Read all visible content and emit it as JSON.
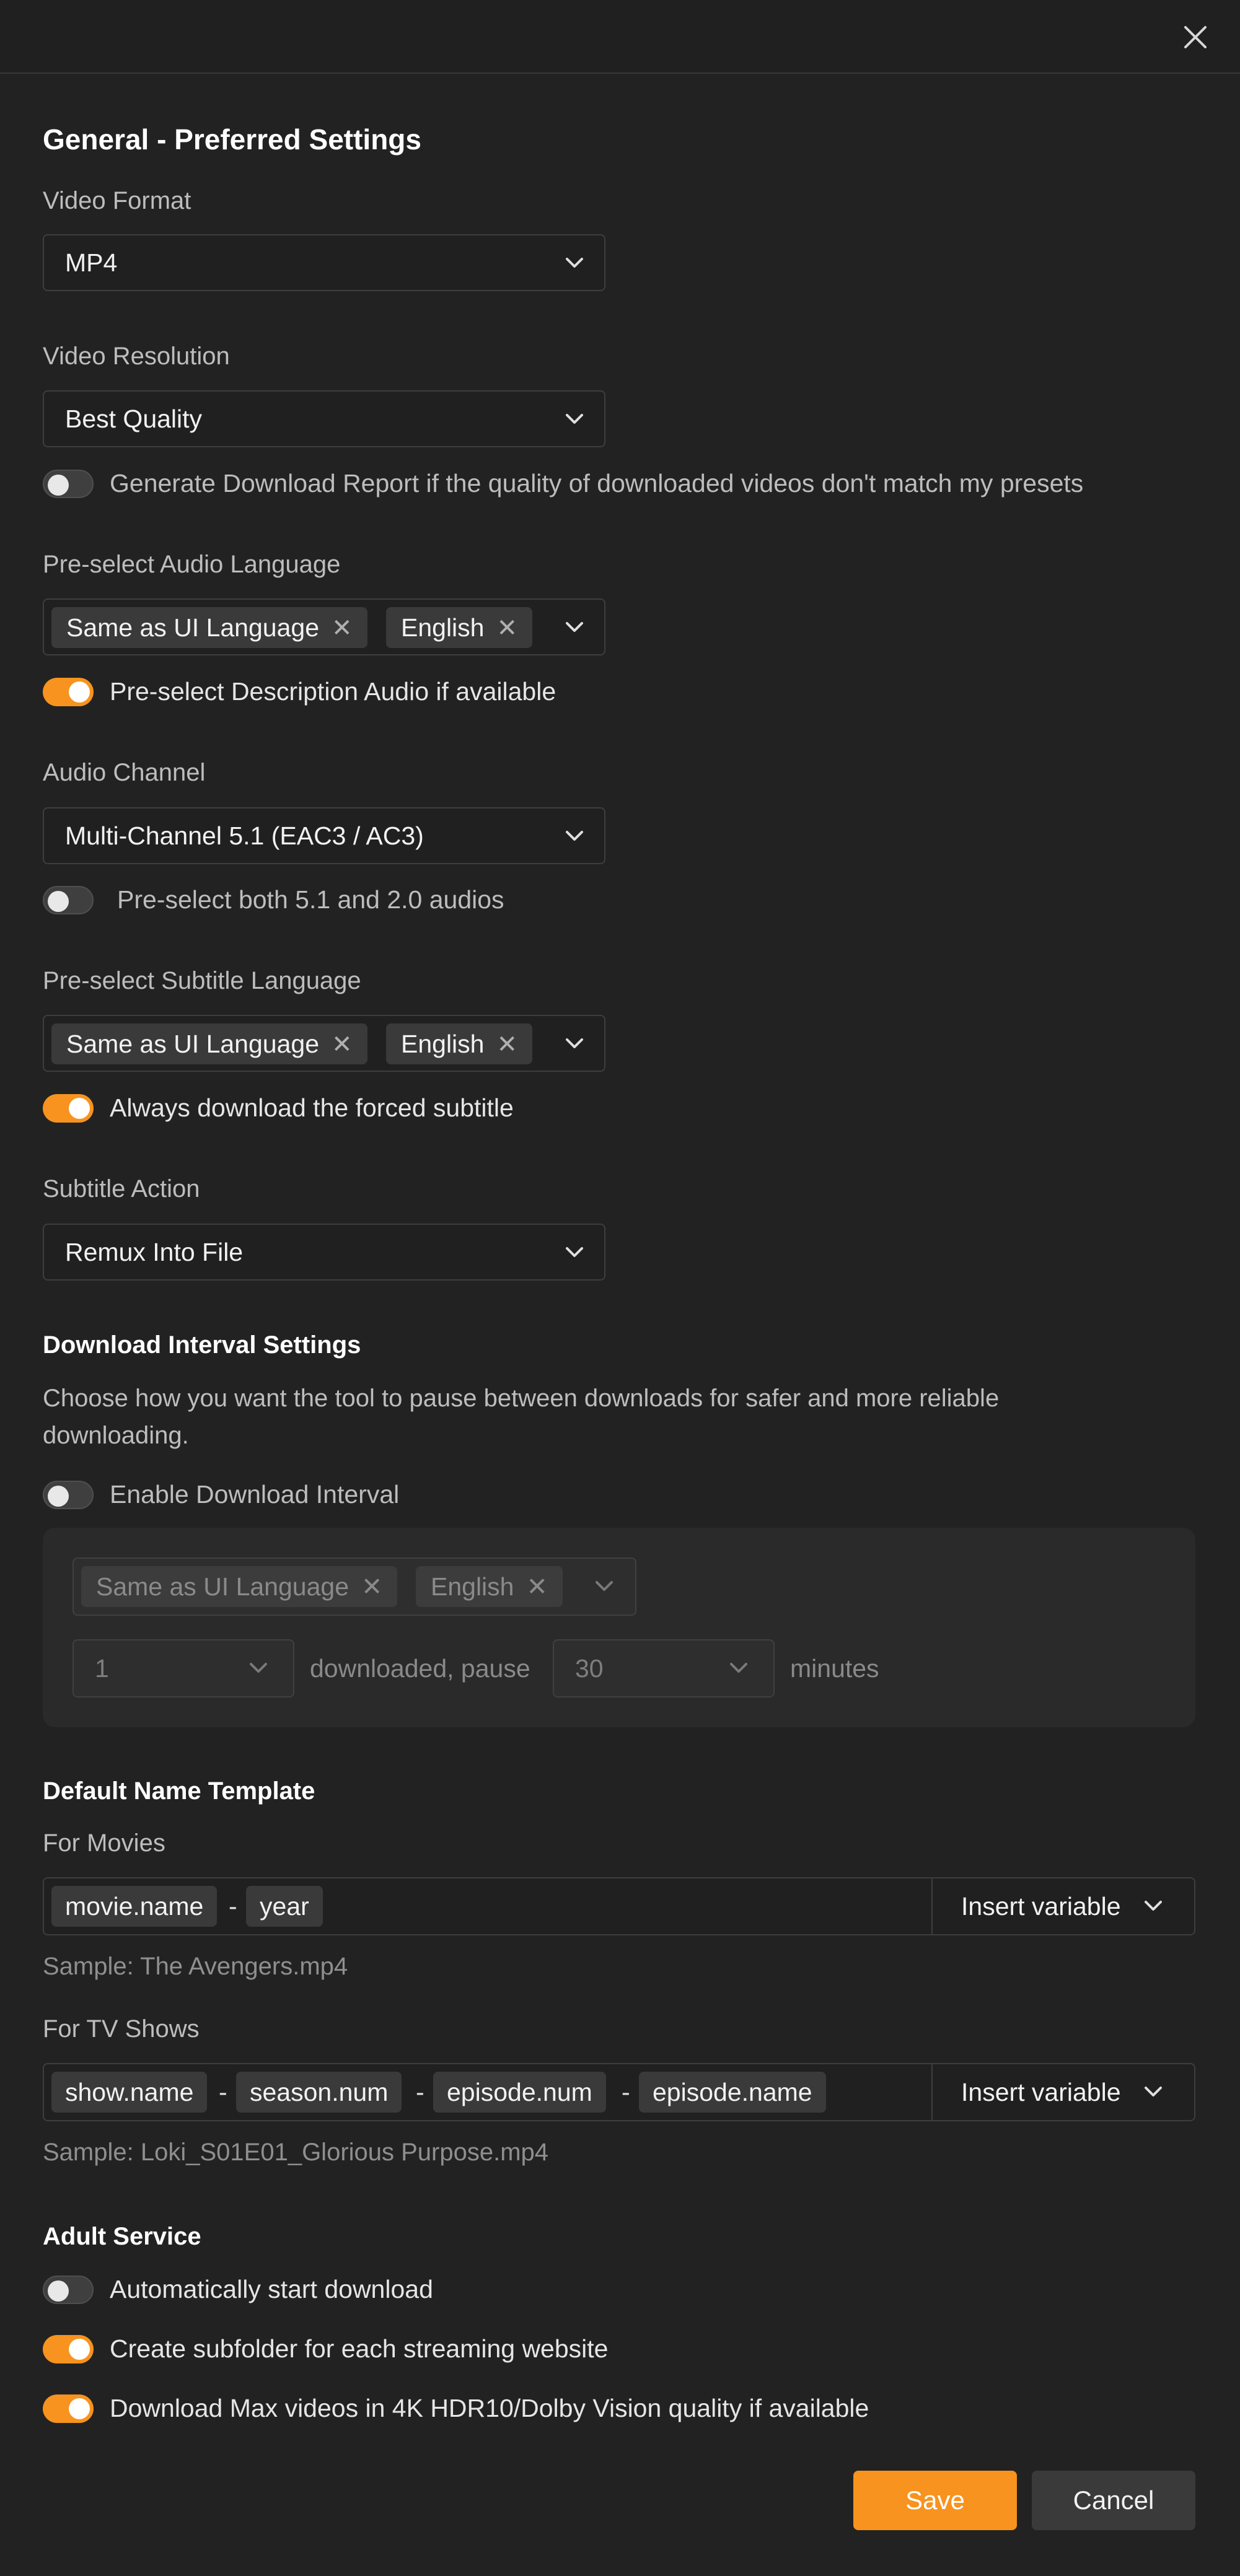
{
  "general": {
    "title": "General - Preferred Settings",
    "video_format": {
      "label": "Video Format",
      "value": "MP4"
    },
    "video_resolution": {
      "label": "Video Resolution",
      "value": "Best Quality"
    },
    "download_report_toggle": {
      "label": "Generate Download Report if the quality of downloaded videos don't match my presets",
      "on": false
    },
    "audio_language": {
      "label": "Pre-select Audio Language",
      "tags": [
        "Same as UI Language",
        "English"
      ]
    },
    "description_audio_toggle": {
      "label": "Pre-select Description Audio if available",
      "on": true
    },
    "audio_channel": {
      "label": "Audio Channel",
      "value": "Multi-Channel 5.1 (EAC3 / AC3)"
    },
    "both_audios_toggle": {
      "label": "Pre-select both 5.1 and 2.0 audios",
      "on": false
    },
    "subtitle_language": {
      "label": "Pre-select Subtitle Language",
      "tags": [
        "Same as UI Language",
        "English"
      ]
    },
    "forced_subtitle_toggle": {
      "label": "Always download the forced subtitle",
      "on": true
    },
    "subtitle_action": {
      "label": "Subtitle Action",
      "value": "Remux Into File"
    }
  },
  "download_interval": {
    "title": "Download Interval Settings",
    "description": "Choose how you want the tool to pause between downloads for safer and more reliable downloading.",
    "enable_toggle": {
      "label": "Enable Download Interval",
      "on": false
    },
    "tags": [
      "Same as UI Language",
      "English"
    ],
    "count_value": "1",
    "middle_text": "downloaded, pause",
    "pause_value": "30",
    "unit_text": "minutes"
  },
  "name_template": {
    "title": "Default Name Template",
    "movies": {
      "label": "For Movies",
      "chips": [
        "movie.name",
        "year"
      ],
      "separator": "-",
      "insert_label": "Insert variable",
      "sample": "Sample: The Avengers.mp4"
    },
    "tv_shows": {
      "label": "For TV Shows",
      "chips": [
        "show.name",
        "season.num",
        "episode.num",
        "episode.name"
      ],
      "separator": "-",
      "insert_label": "Insert variable",
      "sample": "Sample: Loki_S01E01_Glorious Purpose.mp4"
    }
  },
  "adult_service": {
    "title": "Adult Service",
    "auto_start_toggle": {
      "label": "Automatically start download",
      "on": false
    },
    "subfolder_toggle": {
      "label": "Create subfolder for each streaming website",
      "on": true
    },
    "max_4k_toggle": {
      "label": "Download Max videos in 4K HDR10/Dolby Vision quality if available",
      "on": true
    }
  },
  "footer": {
    "save_label": "Save",
    "cancel_label": "Cancel"
  },
  "colors": {
    "accent": "#f7931e",
    "background": "#222222",
    "toggle_off": "#3f3f3f"
  },
  "icons": {
    "close": "close-icon",
    "chevron": "chevron-down-icon",
    "tag_remove": "x-icon"
  }
}
